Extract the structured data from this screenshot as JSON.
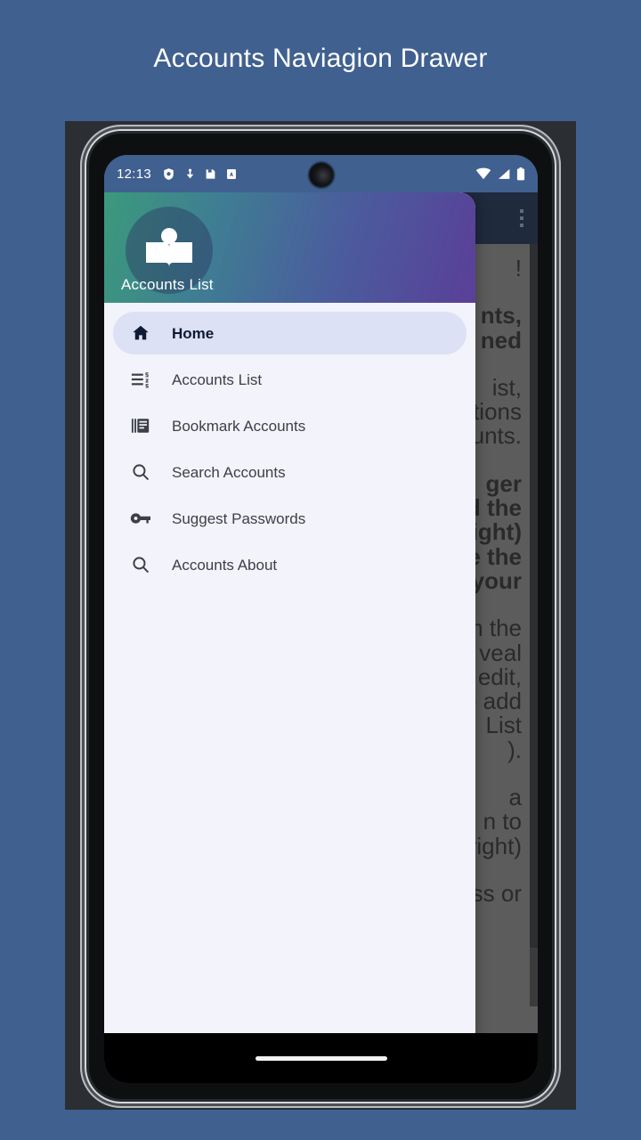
{
  "page": {
    "title": "Accounts Naviagion Drawer",
    "background_color": "#40608f"
  },
  "status_bar": {
    "time": "12:13",
    "left_icons": [
      "clock-shield-icon",
      "download-icon",
      "save-icon",
      "app-badge-icon"
    ],
    "right_icons": [
      "wifi-icon",
      "cellular-signal-icon",
      "battery-icon"
    ]
  },
  "app_bar": {
    "overflow_label": "more-options",
    "background_color": "#1f2a3d"
  },
  "content": {
    "visible_fragments": [
      "!",
      "nts,\nned",
      "ist,\nstions\ncounts.",
      "ger\nd the\night)\ne the\nr your",
      "m the\nveal\nedit,\no add\nList\n).",
      "a\nn to\n-right)",
      "cess or"
    ],
    "scrim_color": "#5c5c5c"
  },
  "drawer": {
    "header": {
      "title": "Accounts List",
      "avatar_icon": "book-education-icon",
      "gradient_start": "#3c9a7b",
      "gradient_end": "#5a3f98"
    },
    "selected_index": 0,
    "selected_background": "#dce1f5",
    "background_color": "#f3f3fb",
    "items": [
      {
        "label": "Home",
        "icon": "home-icon"
      },
      {
        "label": "Accounts List",
        "icon": "list-numbered-icon"
      },
      {
        "label": "Bookmark Accounts",
        "icon": "library-books-icon"
      },
      {
        "label": "Search Accounts",
        "icon": "search-icon"
      },
      {
        "label": "Suggest Passwords",
        "icon": "key-icon"
      },
      {
        "label": "Accounts About",
        "icon": "search-icon"
      }
    ]
  },
  "system_nav": {
    "home_indicator": "home-gesture-bar"
  }
}
